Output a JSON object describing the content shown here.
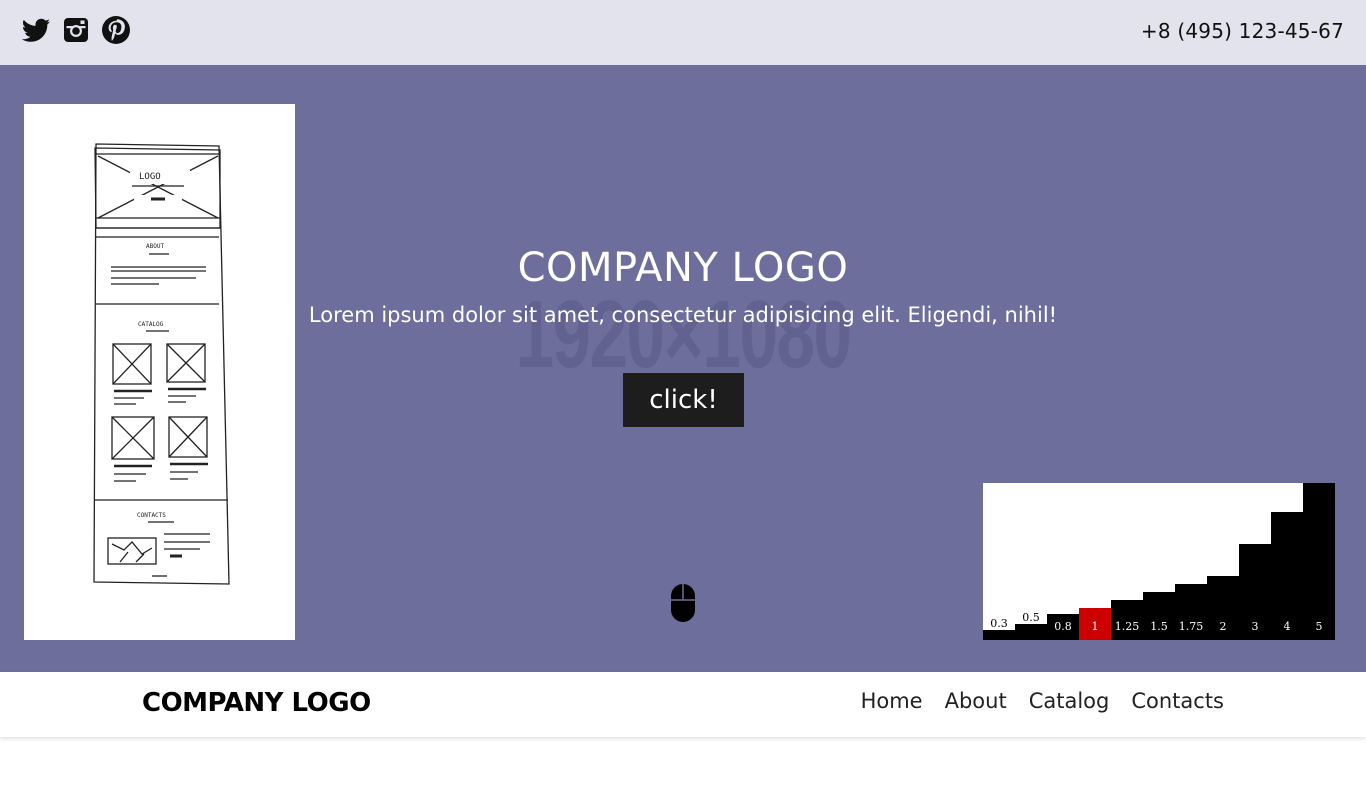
{
  "topbar": {
    "social": [
      {
        "icon": "twitter-icon",
        "label": "Twitter"
      },
      {
        "icon": "instagram-icon",
        "label": "Instagram"
      },
      {
        "icon": "pinterest-icon",
        "label": "Pinterest"
      }
    ],
    "phone": "+8 (495) 123-45-67"
  },
  "hero": {
    "background_color": "#6d6e9b",
    "placeholder_size_text": "1920×1080",
    "title": "COMPANY LOGO",
    "subtitle": "Lorem ipsum dolor sit amet, consectetur adipisicing elit. Eligendi, nihil!",
    "cta_label": "click!",
    "sketch_labels": {
      "logo": "LOGO",
      "about": "ABOUT",
      "catalog": "CATALOG",
      "contacts": "CONTACTS"
    },
    "scale_chart": {
      "labels": [
        "0.3",
        "0.5",
        "0.8",
        "1",
        "1.25",
        "1.5",
        "1.75",
        "2",
        "3",
        "4",
        "5"
      ],
      "highlight": "1",
      "highlight_color": "#cc0000"
    }
  },
  "nav": {
    "brand": "COMPANY LOGO",
    "items": [
      {
        "label": "Home"
      },
      {
        "label": "About"
      },
      {
        "label": "Catalog"
      },
      {
        "label": "Contacts"
      }
    ]
  }
}
